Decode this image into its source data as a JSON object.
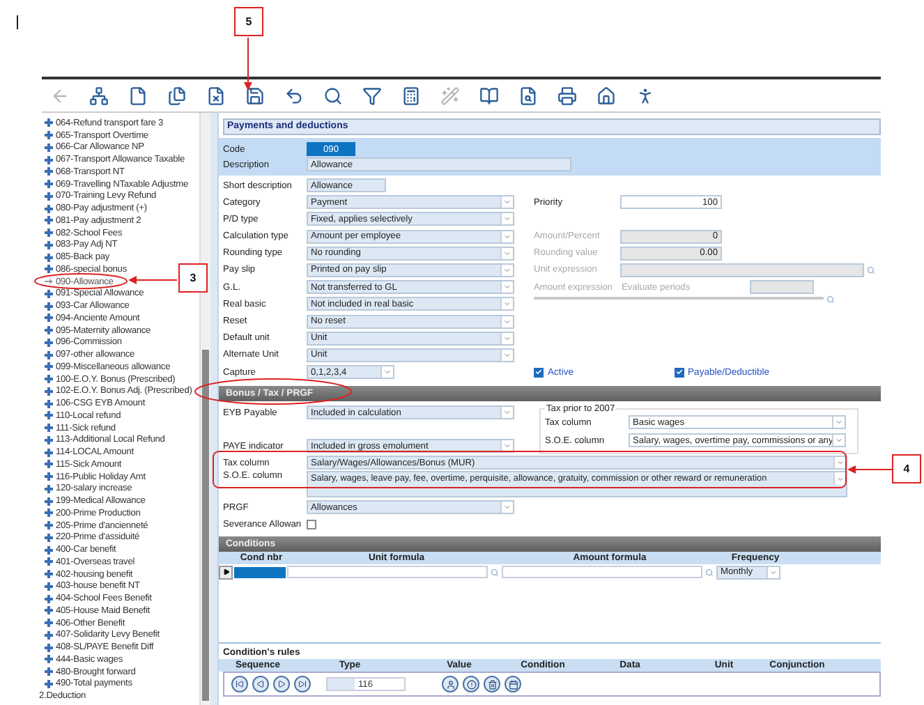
{
  "annotations": [
    {
      "label": "5"
    },
    {
      "label": "3"
    },
    {
      "label": "4"
    }
  ],
  "toolbar": [
    {
      "kind": "back",
      "disabled": true
    },
    {
      "kind": "tree",
      "disabled": false
    },
    {
      "kind": "new",
      "disabled": false
    },
    {
      "kind": "copy",
      "disabled": false
    },
    {
      "kind": "delete",
      "disabled": false
    },
    {
      "kind": "save",
      "disabled": false
    },
    {
      "kind": "undo",
      "disabled": false
    },
    {
      "kind": "search",
      "disabled": false
    },
    {
      "kind": "filter",
      "disabled": false
    },
    {
      "kind": "calc",
      "disabled": false
    },
    {
      "kind": "wand",
      "disabled": true
    },
    {
      "kind": "book",
      "disabled": false
    },
    {
      "kind": "preview",
      "disabled": false
    },
    {
      "kind": "print",
      "disabled": false
    },
    {
      "kind": "home",
      "disabled": false
    },
    {
      "kind": "exit",
      "disabled": false
    }
  ],
  "tree": {
    "items": [
      {
        "label": "064-Refund transport fare 3",
        "kind": "leaf",
        "selected": false
      },
      {
        "label": "065-Transport Overtime",
        "kind": "leaf",
        "selected": false
      },
      {
        "label": "066-Car Allowance NP",
        "kind": "leaf",
        "selected": false
      },
      {
        "label": "067-Transport Allowance Taxable",
        "kind": "leaf",
        "selected": false
      },
      {
        "label": "068-Transport NT",
        "kind": "leaf",
        "selected": false
      },
      {
        "label": "069-Travelling NTaxable Adjustme",
        "kind": "leaf",
        "selected": false
      },
      {
        "label": "070-Training Levy Refund",
        "kind": "leaf",
        "selected": false
      },
      {
        "label": "080-Pay adjustment (+)",
        "kind": "leaf",
        "selected": false
      },
      {
        "label": "081-Pay adjustment 2",
        "kind": "leaf",
        "selected": false
      },
      {
        "label": "082-School Fees",
        "kind": "leaf",
        "selected": false
      },
      {
        "label": "083-Pay Adj NT",
        "kind": "leaf",
        "selected": false
      },
      {
        "label": "085-Back pay",
        "kind": "leaf",
        "selected": false
      },
      {
        "label": "086-special bonus",
        "kind": "leaf",
        "selected": false
      },
      {
        "label": "090-Allowance",
        "kind": "leaf",
        "selected": true
      },
      {
        "label": "091-Special Allowance",
        "kind": "leaf",
        "selected": false
      },
      {
        "label": "093-Car Allowance",
        "kind": "leaf",
        "selected": false
      },
      {
        "label": "094-Anciente Amount",
        "kind": "leaf",
        "selected": false
      },
      {
        "label": "095-Maternity allowance",
        "kind": "leaf",
        "selected": false
      },
      {
        "label": "096-Commission",
        "kind": "leaf",
        "selected": false
      },
      {
        "label": "097-other allowance",
        "kind": "leaf",
        "selected": false
      },
      {
        "label": "099-Miscellaneous allowance",
        "kind": "leaf",
        "selected": false
      },
      {
        "label": "100-E.O.Y. Bonus (Prescribed)",
        "kind": "leaf",
        "selected": false
      },
      {
        "label": "102-E.O.Y. Bonus Adj. (Prescribed)",
        "kind": "leaf",
        "selected": false
      },
      {
        "label": "106-CSG EYB Amount",
        "kind": "leaf",
        "selected": false
      },
      {
        "label": "110-Local refund",
        "kind": "leaf",
        "selected": false
      },
      {
        "label": "111-Sick refund",
        "kind": "leaf",
        "selected": false
      },
      {
        "label": "113-Additional Local Refund",
        "kind": "leaf",
        "selected": false
      },
      {
        "label": "114-LOCAL Amount",
        "kind": "leaf",
        "selected": false
      },
      {
        "label": "115-Sick Amount",
        "kind": "leaf",
        "selected": false
      },
      {
        "label": "116-Public Holiday Amt",
        "kind": "leaf",
        "selected": false
      },
      {
        "label": "120-salary increase",
        "kind": "leaf",
        "selected": false
      },
      {
        "label": "199-Medical Allowance",
        "kind": "leaf",
        "selected": false
      },
      {
        "label": "200-Prime Production",
        "kind": "leaf",
        "selected": false
      },
      {
        "label": "205-Prime d'ancienneté",
        "kind": "leaf",
        "selected": false
      },
      {
        "label": "220-Prime d'assiduité",
        "kind": "leaf",
        "selected": false
      },
      {
        "label": "400-Car benefit",
        "kind": "leaf",
        "selected": false
      },
      {
        "label": "401-Overseas travel",
        "kind": "leaf",
        "selected": false
      },
      {
        "label": "402-housing benefit",
        "kind": "leaf",
        "selected": false
      },
      {
        "label": "403-house benefit NT",
        "kind": "leaf",
        "selected": false
      },
      {
        "label": "404-School Fees Benefit",
        "kind": "leaf",
        "selected": false
      },
      {
        "label": "405-House Maid Benefit",
        "kind": "leaf",
        "selected": false
      },
      {
        "label": "406-Other Benefit",
        "kind": "leaf",
        "selected": false
      },
      {
        "label": "407-Solidarity Levy Benefit",
        "kind": "leaf",
        "selected": false
      },
      {
        "label": "408-SL/PAYE Benefit Diff",
        "kind": "leaf",
        "selected": false
      },
      {
        "label": "444-Basic wages",
        "kind": "leaf",
        "selected": false
      },
      {
        "label": "480-Brought forward",
        "kind": "leaf",
        "selected": false
      },
      {
        "label": "490-Total payments",
        "kind": "leaf",
        "selected": false
      },
      {
        "label": "2.Deduction",
        "kind": "group",
        "selected": false
      }
    ]
  },
  "form": {
    "title": "Payments and deductions",
    "code": {
      "label": "Code",
      "value": "090"
    },
    "description": {
      "label": "Description",
      "value": "Allowance"
    },
    "fields": [
      {
        "label": "Short description",
        "value": "Allowance",
        "kind": "text"
      },
      {
        "label": "Category",
        "value": "Payment",
        "kind": "select"
      },
      {
        "label": "P/D type",
        "value": "Fixed, applies selectively",
        "kind": "select"
      },
      {
        "label": "Calculation type",
        "value": "Amount per employee",
        "kind": "select"
      },
      {
        "label": "Rounding type",
        "value": "No rounding",
        "kind": "select"
      },
      {
        "label": "Pay slip",
        "value": "Printed on pay slip",
        "kind": "select"
      },
      {
        "label": "G.L.",
        "value": "Not transferred to GL",
        "kind": "select"
      },
      {
        "label": "Real basic",
        "value": "Not included in real basic",
        "kind": "select"
      },
      {
        "label": "Reset",
        "value": "No reset",
        "kind": "select"
      },
      {
        "label": "Default unit",
        "value": "Unit",
        "kind": "select"
      },
      {
        "label": "Alternate Unit",
        "value": "Unit",
        "kind": "select"
      },
      {
        "label": "Capture",
        "value": "0,1,2,3,4",
        "kind": "short-select"
      }
    ],
    "priority": {
      "label": "Priority",
      "value": "100"
    },
    "amount_percent": {
      "label": "Amount/Percent",
      "value": "0",
      "disabled": true
    },
    "rounding_value": {
      "label": "Rounding value",
      "value": "0.00",
      "disabled": true
    },
    "unit_expression": {
      "label": "Unit expression",
      "disabled": true
    },
    "amount_expression": {
      "label": "Amount expression",
      "disabled": true
    },
    "evaluate_periods": {
      "label": "Evaluate periods",
      "disabled": true
    },
    "checks": [
      {
        "label": "Active",
        "checked": true
      },
      {
        "label": "Payable/Deductible",
        "checked": true
      }
    ]
  },
  "bonus": {
    "title": "Bonus / Tax / PRGF",
    "eyb": {
      "label": "EYB Payable",
      "value": "Included in calculation"
    },
    "paye": {
      "label": "PAYE indicator",
      "value": "Included in gross emolument"
    },
    "tax_prior": {
      "title": "Tax prior to 2007",
      "tax_column": {
        "label": "Tax column",
        "value": "Basic wages"
      },
      "soe_column": {
        "label": "S.O.E. column",
        "value": "Salary, wages, overtime pay, commissions or any"
      }
    },
    "tax_column": {
      "label": "Tax column",
      "value": "Salary/Wages/Allowances/Bonus (MUR)"
    },
    "soe_column": {
      "label": "S.O.E. column",
      "value": "Salary, wages, leave pay, fee, overtime, perquisite, allowance, gratuity, commission or other reward or remuneration"
    },
    "prgf": {
      "label": "PRGF",
      "value": "Allowances"
    },
    "severance": {
      "label": "Severance Allowan",
      "checked": false
    }
  },
  "conditions": {
    "title": "Conditions",
    "columns": [
      "Cond nbr",
      "Unit formula",
      "Amount formula",
      "Frequency"
    ],
    "frequency": "Monthly"
  },
  "rules": {
    "title": "Condition's rules",
    "columns": [
      "Sequence",
      "Type",
      "Value",
      "Condition",
      "Data",
      "Unit",
      "Conjunction"
    ]
  },
  "navigator": {
    "count": "116"
  }
}
